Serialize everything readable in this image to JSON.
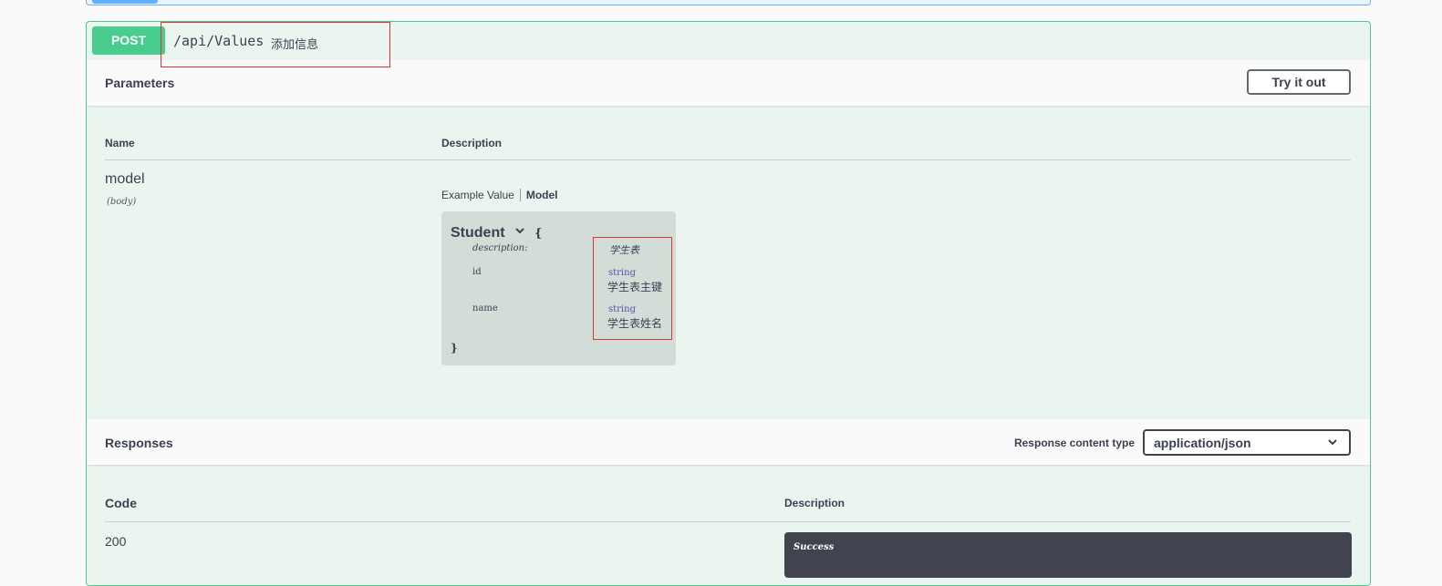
{
  "operation": {
    "method": "POST",
    "path": "/api/Values",
    "summary": "添加信息"
  },
  "parameters": {
    "title": "Parameters",
    "try_button": "Try it out",
    "col_name": "Name",
    "col_description": "Description",
    "items": [
      {
        "name": "model",
        "in": "(body)",
        "tabs": [
          "Example Value",
          "Model"
        ],
        "model": {
          "title": "Student",
          "open_brace": "{",
          "close_brace": "}",
          "description_key": "description:",
          "description_value": "学生表",
          "properties": [
            {
              "key": "id",
              "type": "string",
              "description": "学生表主键"
            },
            {
              "key": "name",
              "type": "string",
              "description": "学生表姓名"
            }
          ]
        }
      }
    ]
  },
  "responses": {
    "title": "Responses",
    "content_type_label": "Response content type",
    "content_type_value": "application/json",
    "col_code": "Code",
    "col_description": "Description",
    "rows": [
      {
        "code": "200",
        "description": "Success"
      }
    ]
  },
  "colors": {
    "post_green": "#49cc90",
    "post_bg": "#ebf5f0",
    "highlight_red": "#e0352b",
    "get_blue": "#61affe"
  }
}
